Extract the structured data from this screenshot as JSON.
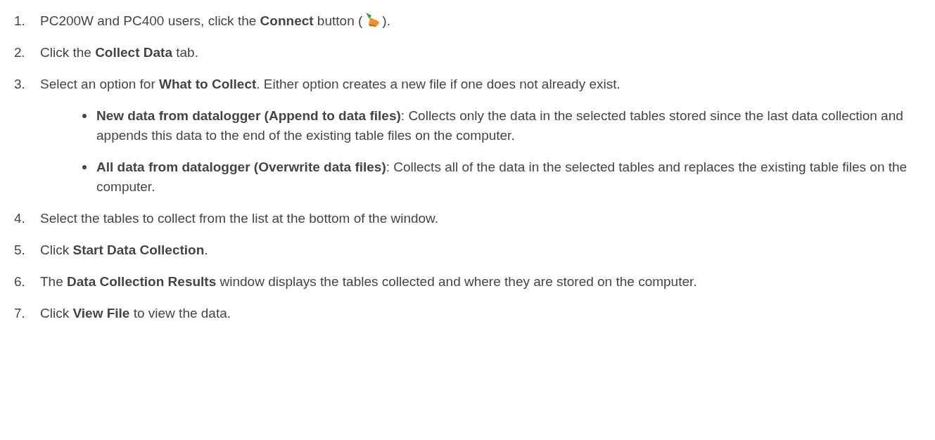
{
  "steps": [
    {
      "number": "1.",
      "text": "PC200W and PC400 users, click the **Connect** button (",
      "text_after": ")."
    },
    {
      "number": "2.",
      "text": "Click the **Collect Data** tab."
    },
    {
      "number": "3.",
      "text": "Select an option for **What to Collect**. Either option creates a new file if one does not already exist.",
      "bullets": [
        {
          "text": "**New data from datalogger (Append to data files)**: Collects only the data in the selected tables stored since the last data collection and appends this data to the end of the existing table files on the computer."
        },
        {
          "text": "**All data from datalogger (Overwrite data files)**: Collects all of the data in the selected tables and replaces the existing table files on the computer."
        }
      ]
    },
    {
      "number": "4.",
      "text": "Select the tables to collect from the list at the bottom of the window."
    },
    {
      "number": "5.",
      "text": "Click **Start Data Collection**."
    },
    {
      "number": "6.",
      "text": "The **Data Collection Results** window displays the tables collected and where they are stored on the computer."
    },
    {
      "number": "7.",
      "text": "Click **View File** to view the data."
    }
  ]
}
